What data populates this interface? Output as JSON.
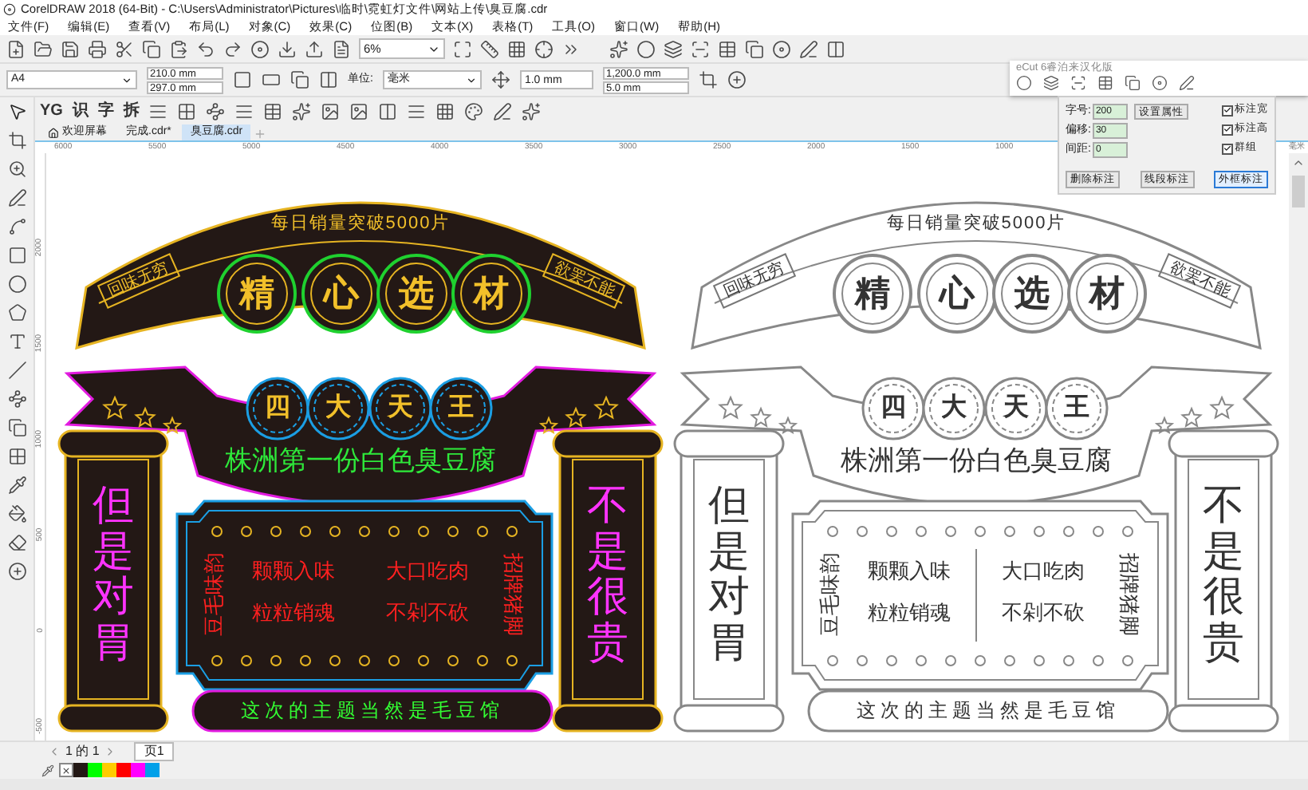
{
  "title_bar": {
    "title": "CorelDRAW 2018 (64-Bit) - C:\\Users\\Administrator\\Pictures\\临时\\霓虹灯文件\\网站上传\\臭豆腐.cdr"
  },
  "menu": [
    "文件(F)",
    "编辑(E)",
    "查看(V)",
    "布局(L)",
    "对象(C)",
    "效果(C)",
    "位图(B)",
    "文本(X)",
    "表格(T)",
    "工具(O)",
    "窗口(W)",
    "帮助(H)"
  ],
  "standard_toolbar": {
    "zoom": "6%"
  },
  "property_bar": {
    "page_size": "A4",
    "width": "210.0 mm",
    "height": "297.0 mm",
    "units_label": "单位:",
    "units": "毫米",
    "nudge": "1.0 mm",
    "duplicate_x": "1,200.0 mm",
    "duplicate_y": "5.0 mm"
  },
  "plugin_toolbar": {
    "buttons": [
      "YG",
      "识",
      "字",
      "拆"
    ]
  },
  "document_tabs": [
    {
      "label": "欢迎屏幕",
      "selected": false,
      "kind": "home"
    },
    {
      "label": "完成.cdr*",
      "selected": false,
      "kind": "file"
    },
    {
      "label": "臭豆腐.cdr",
      "selected": true,
      "kind": "file"
    }
  ],
  "ruler": {
    "h_labels": [
      "6000",
      "5500",
      "5000",
      "4500",
      "4000",
      "3500",
      "3000",
      "2500",
      "2000",
      "1500",
      "1000"
    ],
    "units": "毫米",
    "v_labels": [
      "2000",
      "1500",
      "1000",
      "500",
      "0",
      "-500"
    ]
  },
  "designs": [
    {
      "kind": "neon",
      "arch_text": "每日销量突破5000片",
      "left_tag": "回味无穷",
      "right_tag": "欲罢不能",
      "title_chars": [
        "精",
        "心",
        "选",
        "材"
      ],
      "crown_chars": [
        "四",
        "大",
        "天",
        "王"
      ],
      "ribbon_text": "株洲第一份白色臭豆腐",
      "left_pillar": "但是对胃",
      "right_pillar": "不是很贵",
      "panel_left": "豆毛味韵",
      "panel_right": "招牌猪脚",
      "panel_lines": [
        "颗颗入味",
        "大口吃肉",
        "粒粒销魂",
        "不剁不砍"
      ],
      "footer": "这次的主题当然是毛豆馆"
    },
    {
      "kind": "outline",
      "arch_text": "每日销量突破5000片",
      "left_tag": "回味无穷",
      "right_tag": "欲罢不能",
      "title_chars": [
        "精",
        "心",
        "选",
        "材"
      ],
      "crown_chars": [
        "四",
        "大",
        "天",
        "王"
      ],
      "ribbon_text": "株洲第一份白色臭豆腐",
      "left_pillar": "但是对胃",
      "right_pillar": "不是很贵",
      "panel_left": "豆毛味韵",
      "panel_right": "招牌猪脚",
      "panel_lines": [
        "颗颗入味",
        "大口吃肉",
        "粒粒销魂",
        "不剁不砍"
      ],
      "footer": "这次的主题当然是毛豆馆"
    }
  ],
  "ecut_panel": {
    "title": "eCut 6睿泊来汉化版",
    "fields": [
      {
        "label": "字号:",
        "value": "200"
      },
      {
        "label": "偏移:",
        "value": "30"
      },
      {
        "label": "间距:",
        "value": "0"
      }
    ],
    "set_button": "设置属性",
    "options": [
      {
        "label": "标注宽",
        "checked": true
      },
      {
        "label": "标注高",
        "checked": true
      },
      {
        "label": "群组",
        "checked": true
      }
    ],
    "buttons": [
      {
        "label": "删除标注",
        "selected": false
      },
      {
        "label": "线段标注",
        "selected": false
      },
      {
        "label": "外框标注",
        "selected": true
      }
    ]
  },
  "page_nav": {
    "count": "1 的 1",
    "page_tab": "页1"
  },
  "palette": [
    {
      "kind": "none"
    },
    {
      "kind": "swatch",
      "color": "#231815"
    },
    {
      "kind": "swatch",
      "color": "#00ff00"
    },
    {
      "kind": "swatch",
      "color": "#ffcc00"
    },
    {
      "kind": "swatch",
      "color": "#ff0000"
    },
    {
      "kind": "swatch",
      "color": "#ff00ff"
    },
    {
      "kind": "swatch",
      "color": "#00a0e9"
    }
  ]
}
